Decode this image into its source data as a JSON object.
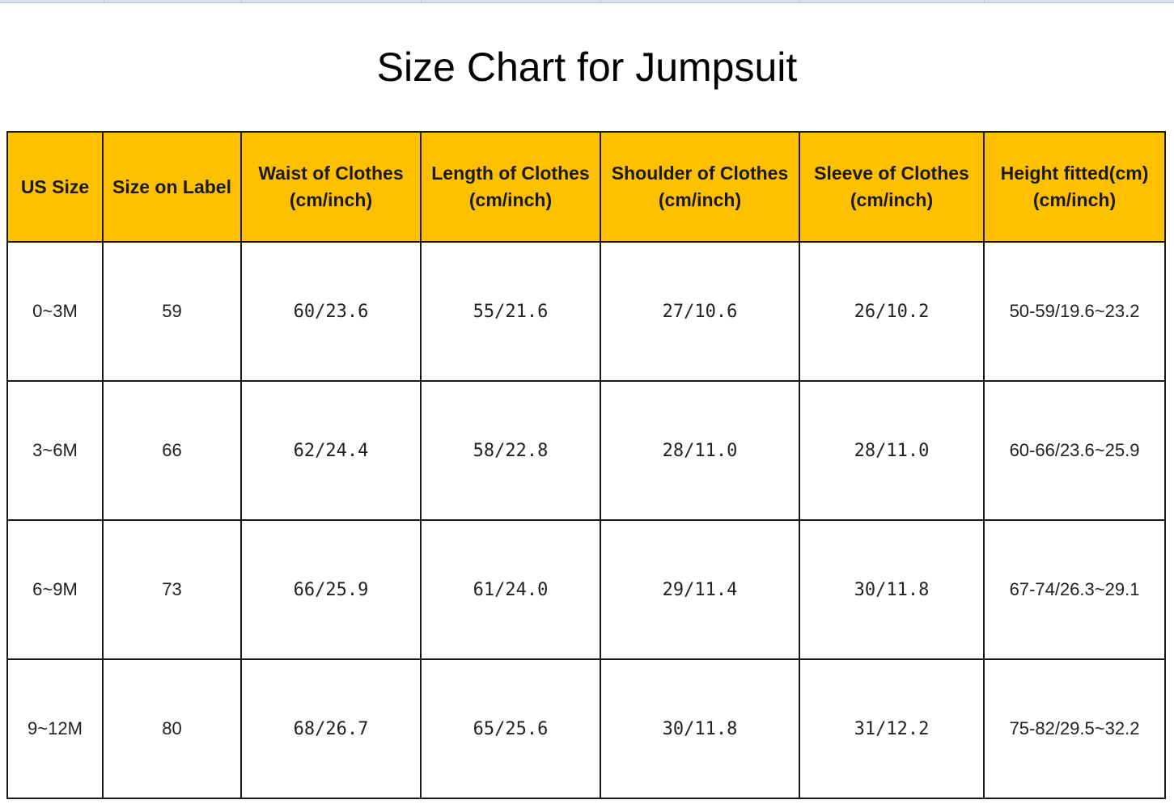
{
  "chart_data": {
    "type": "table",
    "title": "Size Chart for Jumpsuit",
    "columns": [
      {
        "line1": "US Size",
        "line2": ""
      },
      {
        "line1": "Size on Label",
        "line2": ""
      },
      {
        "line1": "Waist of Clothes",
        "line2": "(cm/inch)"
      },
      {
        "line1": "Length of Clothes",
        "line2": "(cm/inch)"
      },
      {
        "line1": "Shoulder of Clothes",
        "line2": "(cm/inch)"
      },
      {
        "line1": "Sleeve of Clothes",
        "line2": "(cm/inch)"
      },
      {
        "line1": "Height fitted(cm)",
        "line2": "(cm/inch)"
      }
    ],
    "rows": [
      [
        "0~3M",
        "59",
        "60/23.6",
        "55/21.6",
        "27/10.6",
        "26/10.2",
        "50-59/19.6~23.2"
      ],
      [
        "3~6M",
        "66",
        "62/24.4",
        "58/22.8",
        "28/11.0",
        "28/11.0",
        "60-66/23.6~25.9"
      ],
      [
        "6~9M",
        "73",
        "66/25.9",
        "61/24.0",
        "29/11.4",
        "30/11.8",
        "67-74/26.3~29.1"
      ],
      [
        "9~12M",
        "80",
        "68/26.7",
        "65/25.6",
        "30/11.8",
        "31/12.2",
        "75-82/29.5~32.2"
      ]
    ]
  },
  "colors": {
    "header_background": "#ffc000",
    "border": "#1a1a1a",
    "text": "#222222"
  }
}
